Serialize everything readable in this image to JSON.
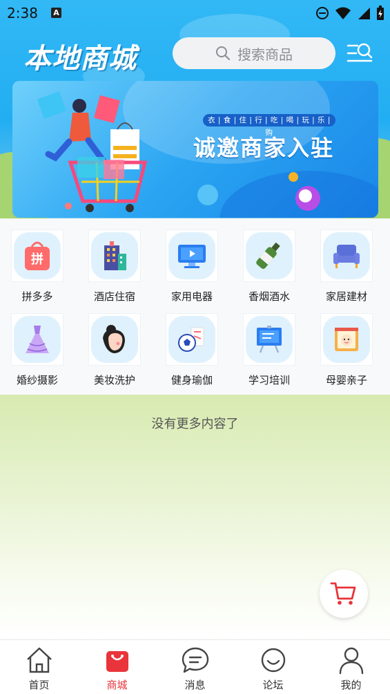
{
  "status_bar": {
    "time": "2:38",
    "a_badge": "A"
  },
  "header": {
    "logo_text": "本地商城",
    "search_placeholder": "搜索商品",
    "menu_icon": "menu-search-icon"
  },
  "banner": {
    "tagline": "衣 | 食 | 住 | 行 | 吃 | 喝 | 玩 | 乐 | 购",
    "title": "诚邀商家入驻"
  },
  "categories": [
    {
      "label": "拼多多",
      "icon": "pinduoduo-bag-icon"
    },
    {
      "label": "酒店住宿",
      "icon": "hotel-building-icon"
    },
    {
      "label": "家用电器",
      "icon": "tv-monitor-icon"
    },
    {
      "label": "香烟酒水",
      "icon": "wine-bottle-icon"
    },
    {
      "label": "家居建材",
      "icon": "sofa-icon"
    },
    {
      "label": "婚纱摄影",
      "icon": "wedding-dress-icon"
    },
    {
      "label": "美妆洗护",
      "icon": "woman-face-icon"
    },
    {
      "label": "健身瑜伽",
      "icon": "soccer-ball-icon"
    },
    {
      "label": "学习培训",
      "icon": "presentation-board-icon"
    },
    {
      "label": "母婴亲子",
      "icon": "baby-icon"
    }
  ],
  "content": {
    "empty_text": "没有更多内容了"
  },
  "bottom_nav": {
    "items": [
      {
        "label": "首页",
        "icon": "home-icon"
      },
      {
        "label": "商城",
        "icon": "shopping-bag-icon"
      },
      {
        "label": "消息",
        "icon": "chat-bubble-icon"
      },
      {
        "label": "论坛",
        "icon": "smile-face-icon"
      },
      {
        "label": "我的",
        "icon": "person-icon"
      }
    ],
    "active_index": 1,
    "active_color": "#e8343a"
  },
  "colors": {
    "header_blue": "#22aef2",
    "accent_red": "#e8343a",
    "tile_bg": "#dff1fc"
  }
}
